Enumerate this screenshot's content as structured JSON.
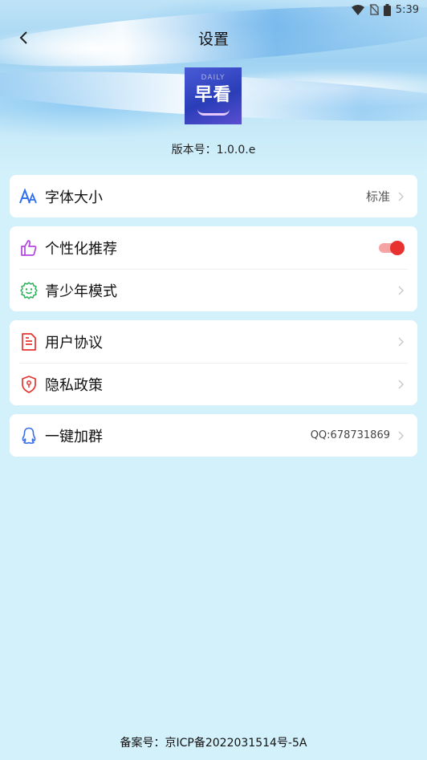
{
  "status_bar": {
    "time": "5:39"
  },
  "header": {
    "title": "设置"
  },
  "app": {
    "logo_small": "DAILY",
    "logo_text": "早看",
    "version": "版本号：1.0.0.e"
  },
  "settings": {
    "font_size": {
      "label": "字体大小",
      "value": "标准"
    },
    "personalized": {
      "label": "个性化推荐",
      "enabled": true
    },
    "teen_mode": {
      "label": "青少年模式"
    },
    "user_agreement": {
      "label": "用户协议"
    },
    "privacy_policy": {
      "label": "隐私政策"
    },
    "join_group": {
      "label": "一键加群",
      "value": "QQ:678731869"
    }
  },
  "footer": {
    "icp": "备案号：京ICP备2022031514号-5A"
  },
  "colors": {
    "background": "#d3f1fb",
    "accent_blue": "#2f6ff0",
    "icon_purple": "#b344e0",
    "icon_green": "#2bb35a",
    "icon_red": "#e8322f",
    "icon_blue": "#3a6ee8",
    "toggle_on": "#e8322f"
  }
}
